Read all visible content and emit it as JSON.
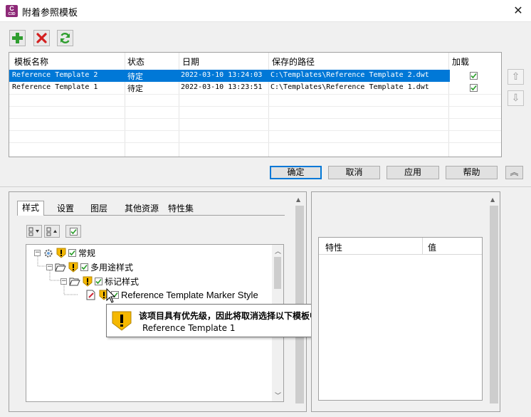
{
  "window": {
    "title": "附着参照模板",
    "app_icon_letter": "C",
    "app_icon_sub": "C3D",
    "close_glyph": "✕"
  },
  "toolbar": {
    "add_icon": "plus-icon",
    "remove_icon": "red-x-icon",
    "refresh_icon": "refresh-icon"
  },
  "templates_table": {
    "headers": [
      "模板名称",
      "状态",
      "日期",
      "保存的路径",
      "加载"
    ],
    "rows": [
      {
        "name": "Reference Template 2",
        "status": "待定",
        "date": "2022-03-10 13:24:03",
        "path": "C:\\Templates\\Reference Template 2.dwt",
        "loaded": true,
        "selected": true
      },
      {
        "name": "Reference Template 1",
        "status": "待定",
        "date": "2022-03-10 13:23:51",
        "path": "C:\\Templates\\Reference Template 1.dwt",
        "loaded": true,
        "selected": false
      }
    ]
  },
  "side_buttons": {
    "move_up_glyph": "⇧",
    "move_down_glyph": "⇩",
    "collapse_glyph": "︽"
  },
  "buttons": {
    "ok": "确定",
    "cancel": "取消",
    "apply": "应用",
    "help": "帮助"
  },
  "tabs": [
    "样式",
    "设置",
    "图层",
    "其他资源",
    "特性集"
  ],
  "tree": {
    "root": "常规",
    "child": "多用途样式",
    "grandchild": "标记样式",
    "leaf": "Reference Template Marker Style"
  },
  "tooltip": {
    "heading": "该项目具有优先级，因此将取消选择以下模板中的该项目:",
    "detail": "Reference Template 1"
  },
  "properties": {
    "headers": [
      "特性",
      "值"
    ]
  },
  "colors": {
    "selection": "#0078d7",
    "warning": "#f5b800",
    "check": "#2a9d2a",
    "app_icon": "#8e2a78"
  }
}
